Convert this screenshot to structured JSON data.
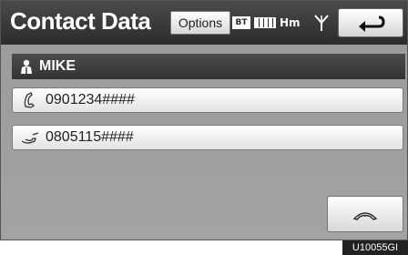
{
  "header": {
    "title": "Contact Data",
    "options_label": "Options",
    "status": {
      "bt_label": "BT",
      "hm_label": "Hm",
      "icons": [
        "bluetooth-icon",
        "battery-icon",
        "antenna-icon"
      ]
    },
    "back_icon": "back-arrow-icon"
  },
  "contact": {
    "icon": "person-icon",
    "name": "MIKE"
  },
  "numbers": [
    {
      "icon": "mobile-phone-icon",
      "value": "0901234####"
    },
    {
      "icon": "home-phone-icon",
      "value": "0805115####"
    }
  ],
  "footer": {
    "call_icon": "call-icon"
  },
  "watermark": "U10055GI",
  "colors": {
    "screen_bg": "#a0a0a0",
    "title_bar": "#333333",
    "button_bg": "#ffffff"
  }
}
